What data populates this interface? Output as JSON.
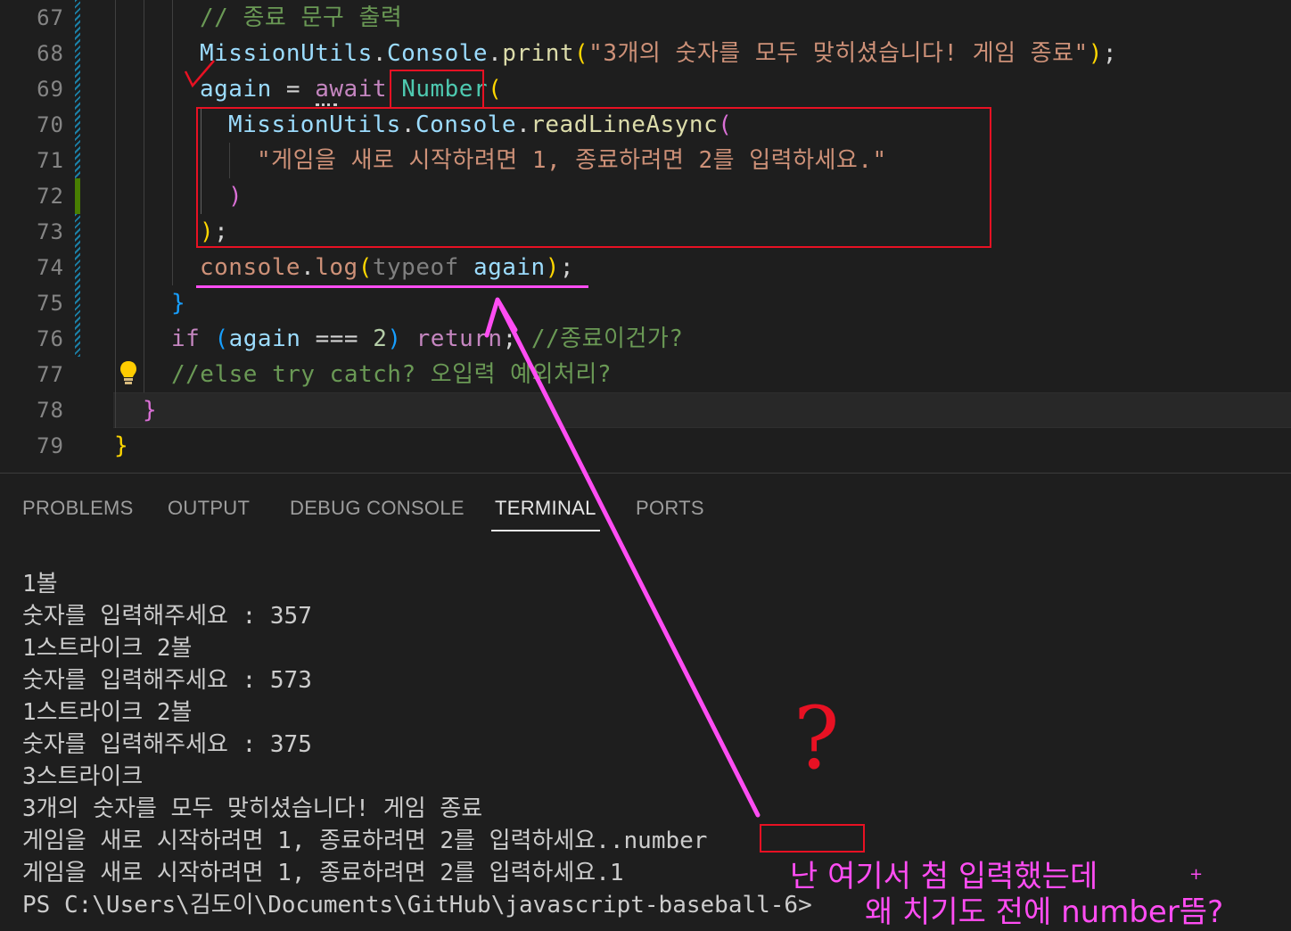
{
  "editor": {
    "lines": [
      {
        "n": "67",
        "t": "// 종료 문구 출력"
      },
      {
        "n": "68",
        "a": "MissionUtils",
        "b": "Console",
        "c": "print",
        "s": "\"3개의 숫자를 모두 맞히셨습니다! 게임 종료\""
      },
      {
        "n": "69",
        "a": "again",
        "b": "await",
        "c": "Number"
      },
      {
        "n": "70",
        "a": "MissionUtils",
        "b": "Console",
        "c": "readLineAsync"
      },
      {
        "n": "71",
        "s": "\"게임을 새로 시작하려면 1, 종료하려면 2를 입력하세요.\""
      },
      {
        "n": "72"
      },
      {
        "n": "73"
      },
      {
        "n": "74",
        "a": "console",
        "c": "log",
        "k": "typeof",
        "v": "again"
      },
      {
        "n": "75"
      },
      {
        "n": "76",
        "k": "if",
        "v": "again",
        "o": "===",
        "num": "2",
        "r": "return",
        "t": "//종료이건가?"
      },
      {
        "n": "77",
        "t": "//else try catch? 오입력 예외처리?"
      },
      {
        "n": "78"
      },
      {
        "n": "79"
      }
    ]
  },
  "panel": {
    "tabs": [
      "PROBLEMS",
      "OUTPUT",
      "DEBUG CONSOLE",
      "TERMINAL",
      "PORTS"
    ],
    "active_tab": "TERMINAL",
    "terminal_lines": [
      "1볼",
      "숫자를 입력해주세요 : 357",
      "1스트라이크 2볼",
      "숫자를 입력해주세요 : 573",
      "1스트라이크 2볼",
      "숫자를 입력해주세요 : 375",
      "3스트라이크",
      "3개의 숫자를 모두 맞히셨습니다! 게임 종료",
      "게임을 새로 시작하려면 1, 종료하려면 2를 입력하세요.",
      "게임을 새로 시작하려면 1, 종료하려면 2를 입력하세요.1",
      "PS C:\\Users\\김도이\\Documents\\GitHub\\javascript-baseball-6>"
    ],
    "number_output": ".number"
  },
  "annotations": {
    "note_line1": "난 여기서 첨 입력했는데",
    "note_line2": "왜 치기도 전에 number뜸?",
    "question_mark": "?",
    "check_mark": "✓",
    "plus": "+",
    "color_pink": "#ff4df3",
    "color_red": "#e81123"
  }
}
